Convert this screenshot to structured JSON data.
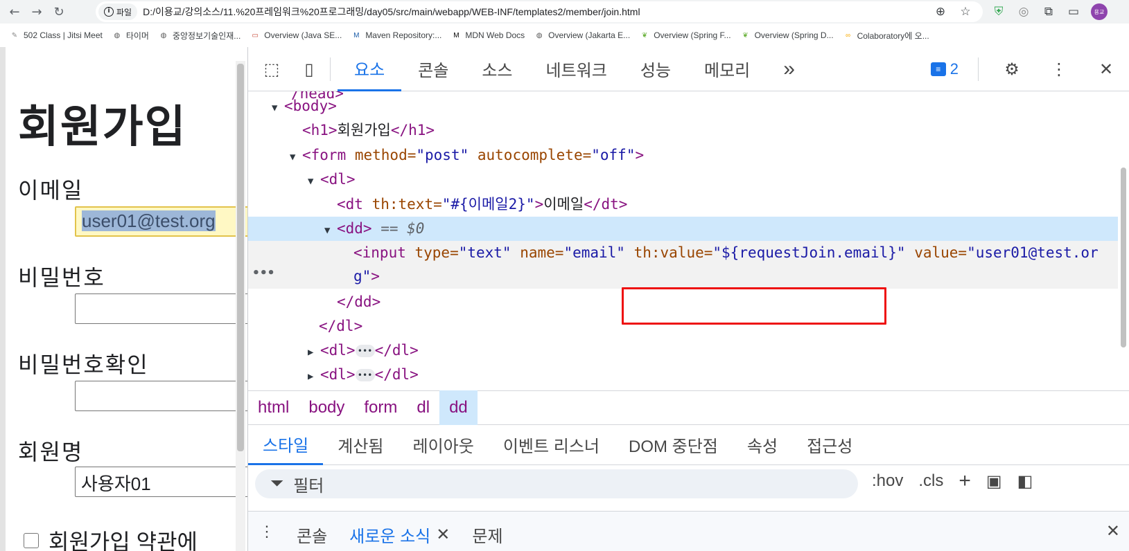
{
  "browser": {
    "chip_label": "파일",
    "url": "D:/이용교/강의소스/11.%20프레임워크%20프로그래밍/day05/src/main/webapp/WEB-INF/templates2/member/join.html",
    "avatar_label": "용교"
  },
  "bookmarks": [
    {
      "label": "502 Class | Jitsi Meet",
      "icon": "jitsi-icon",
      "color": "#888888"
    },
    {
      "label": "타이머",
      "icon": "globe-icon",
      "color": "#555555"
    },
    {
      "label": "중앙정보기술인재...",
      "icon": "globe-icon",
      "color": "#555555"
    },
    {
      "label": "Overview (Java SE...",
      "icon": "oracle-icon",
      "color": "#c74634"
    },
    {
      "label": "Maven Repository:...",
      "icon": "maven-icon",
      "color": "#1a5ca8"
    },
    {
      "label": "MDN Web Docs",
      "icon": "mdn-icon",
      "color": "#000000"
    },
    {
      "label": "Overview (Jakarta E...",
      "icon": "globe-icon",
      "color": "#555555"
    },
    {
      "label": "Overview (Spring F...",
      "icon": "spring-icon",
      "color": "#6db33f"
    },
    {
      "label": "Overview (Spring D...",
      "icon": "spring-icon",
      "color": "#6db33f"
    },
    {
      "label": "Colaboratory에 오...",
      "icon": "colab-icon",
      "color": "#f9ab00"
    }
  ],
  "page": {
    "title": "회원가입",
    "email_label": "이메일",
    "email_value": "user01@test.org",
    "password_label": "비밀번호",
    "password_confirm_label": "비밀번호확인",
    "name_label": "회원명",
    "name_value": "사용자01",
    "agree_label": "회원가입 약관에"
  },
  "devtools": {
    "tabs": [
      "요소",
      "콘솔",
      "소스",
      "네트워크",
      "성능",
      "메모리"
    ],
    "more_tabs": "»",
    "issues_count": "2",
    "code": {
      "head_fragment": "/head>",
      "body_open": "<body>",
      "h1_open": "<h1>",
      "h1_text": "회원가입",
      "h1_close": "</h1>",
      "form_open": "<form",
      "form_attr1": " method=",
      "form_val1": "\"post\"",
      "form_attr2": " autocomplete=",
      "form_val2": "\"off\"",
      "form_close_bracket": ">",
      "dl_open": "<dl>",
      "dt_open": "<dt",
      "dt_attr": " th:text=",
      "dt_val": "\"#{이메일2}\"",
      "dt_gt": ">",
      "dt_text": "이메일",
      "dt_close": "</dt>",
      "dd_open": "<dd>",
      "dd_eq": " == $0",
      "input_open": "<input",
      "input_attr1": " type=",
      "input_val1": "\"text\"",
      "input_attr2": " name=",
      "input_val2": "\"email\"",
      "input_attr3": " th:value=",
      "input_val3": "\"${requestJoin.email}\"",
      "input_attr4": " value=",
      "input_val4a": "\"user01@test.or",
      "input_val4b": "g\"",
      "input_gt": ">",
      "dd_close": "</dd>",
      "dl_close": "</dl>",
      "dl_collapsed_open": "<dl>",
      "dl_collapsed_dots": "•••",
      "dl_collapsed_close": "</dl>"
    },
    "breadcrumbs": [
      "html",
      "body",
      "form",
      "dl",
      "dd"
    ],
    "styles_tabs": [
      "스타일",
      "계산됨",
      "레이아웃",
      "이벤트 리스너",
      "DOM 중단점",
      "속성",
      "접근성"
    ],
    "filter_placeholder": "필터",
    "hov": ":hov",
    "cls": ".cls",
    "drawer_tabs": [
      "콘솔",
      "새로운 소식",
      "문제"
    ]
  }
}
